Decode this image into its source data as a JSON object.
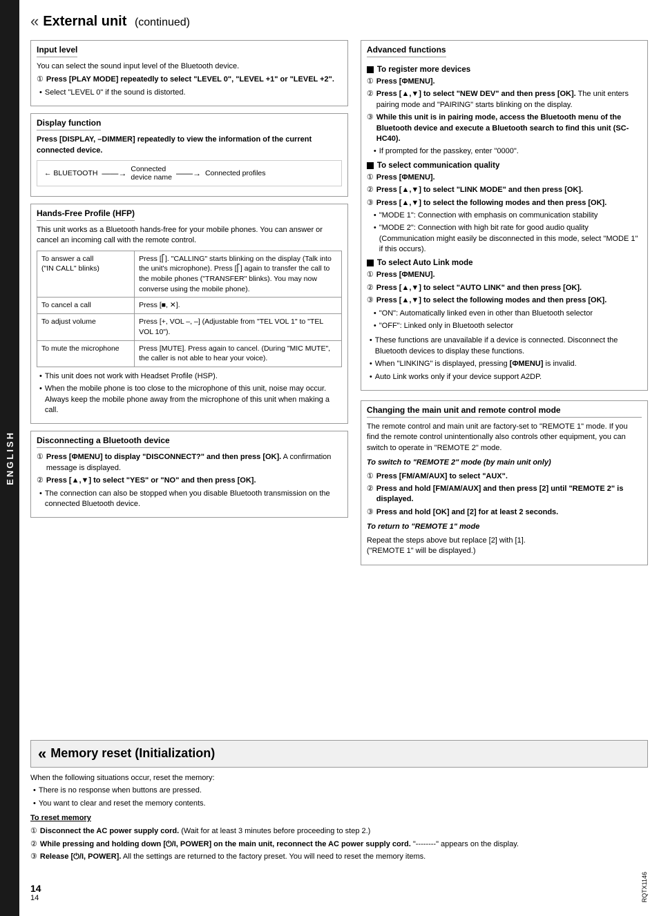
{
  "page": {
    "title": "External unit",
    "title_continued": "(continued)",
    "sidebar_label": "ENGLISH",
    "page_number": "14",
    "doc_code": "RQTX1146",
    "header_icon": "«"
  },
  "input_level": {
    "title": "Input level",
    "description": "You can select the sound input level of the Bluetooth device.",
    "step1": "Press [PLAY MODE] repeatedly to select \"LEVEL 0\", \"LEVEL +1\" or \"LEVEL +2\".",
    "bullet1": "Select \"LEVEL 0\" if the sound is distorted."
  },
  "display_function": {
    "title": "Display function",
    "description": "Press [DISPLAY, –DIMMER] repeatedly to view the information of the current connected device.",
    "diagram": {
      "start": "BLUETOOTH",
      "arrow1": "→",
      "mid": "Connected device name",
      "arrow2": "→",
      "end": "Connected profiles"
    }
  },
  "hfp": {
    "title": "Hands-Free Profile (HFP)",
    "description": "This unit works as a Bluetooth hands-free for your mobile phones. You can answer or cancel an incoming call with the remote control.",
    "table_rows": [
      {
        "action": "To answer a call (\"IN CALL\" blinks)",
        "description": "Press [  ]. \"CALLING\" starts blinking on the display (Talk into the unit's microphone). Press [  ] again to transfer the call to the mobile phones (\"TRANSFER\" blinks). You may now converse using the mobile phone)."
      },
      {
        "action": "To cancel a call",
        "description": "Press [■, ✕]."
      },
      {
        "action": "To adjust volume",
        "description": "Press [+, VOL –, –] (Adjustable from \"TEL VOL 1\" to \"TEL VOL 10\")."
      },
      {
        "action": "To mute the microphone",
        "description": "Press [MUTE]. Press again to cancel. (During \"MIC MUTE\", the caller is not able to hear your voice)."
      }
    ],
    "bullets": [
      "This unit does not work with Headset Profile (HSP).",
      "When the mobile phone is too close to the microphone of this unit, noise may occur. Always keep the mobile phone away from the microphone of this unit when making a call."
    ]
  },
  "disconnecting": {
    "title": "Disconnecting a Bluetooth device",
    "step1": "Press [ΦMENU] to display \"DISCONNECT?\" and then press [OK]. A confirmation message is displayed.",
    "step2": "Press [▲,▼] to select \"YES\" or \"NO\" and then press [OK].",
    "bullet1": "The connection can also be stopped when you disable Bluetooth transmission on the connected Bluetooth device."
  },
  "advanced_functions": {
    "title": "Advanced functions",
    "register_title": "To register more devices",
    "register_steps": [
      "Press [ΦMENU].",
      "Press [▲,▼] to select \"NEW DEV\" and then press [OK]. The unit enters pairing mode and \"PAIRING\" starts blinking on the display.",
      "While this unit is in pairing mode, access the Bluetooth menu of the Bluetooth device and execute a Bluetooth search to find this unit (SC-HC40)."
    ],
    "register_bullet": "If prompted for the passkey, enter \"0000\".",
    "comm_quality_title": "To select communication quality",
    "comm_quality_steps": [
      "Press [ΦMENU].",
      "Press [▲,▼] to select \"LINK MODE\" and then press [OK].",
      "Press [▲,▼] to select the following modes and then press [OK]."
    ],
    "comm_quality_bullets": [
      "\"MODE 1\": Connection with emphasis on communication stability",
      "\"MODE 2\": Connection with high bit rate for good audio quality (Communication might easily be disconnected in this mode, select \"MODE 1\" if this occurs)."
    ],
    "auto_link_title": "To select Auto Link mode",
    "auto_link_steps": [
      "Press [ΦMENU].",
      "Press [▲,▼] to select \"AUTO LINK\" and then press [OK].",
      "Press [▲,▼] to select the following modes and then press [OK]."
    ],
    "auto_link_bullets": [
      "\"ON\": Automatically linked even in other than Bluetooth selector",
      "\"OFF\": Linked only in Bluetooth selector"
    ],
    "extra_bullets": [
      "These functions are unavailable if a device is connected. Disconnect the Bluetooth devices to display these functions.",
      "When \"LINKING\" is displayed, pressing [ΦMENU] is invalid.",
      "Auto Link works only if your device support A2DP."
    ]
  },
  "changing_mode": {
    "title": "Changing the main unit and remote control mode",
    "description": "The remote control and main unit are factory-set to \"REMOTE 1\" mode. If you find the remote control unintentionally also controls other equipment, you can switch to operate in \"REMOTE 2\" mode.",
    "remote2_title": "To switch to \"REMOTE 2\" mode (by main unit only)",
    "remote2_steps": [
      "Press [FM/AM/AUX] to select \"AUX\".",
      "Press and hold [FM/AM/AUX] and then press [2] until \"REMOTE 2\" is displayed.",
      "Press and hold [OK] and [2] for at least 2 seconds."
    ],
    "remote1_title": "To return to \"REMOTE 1\" mode",
    "remote1_description": "Repeat the steps above but replace [2] with [1]. (\"REMOTE 1\" will be displayed.)"
  },
  "memory_reset": {
    "title": "Memory reset (Initialization)",
    "icon": "«",
    "description": "When the following situations occur, reset the memory:",
    "bullets": [
      "There is no response when buttons are pressed.",
      "You want to clear and reset the memory contents."
    ],
    "reset_title": "To reset memory",
    "steps": [
      "Disconnect the AC power supply cord. (Wait for at least 3 minutes before proceeding to step 2.)",
      "While pressing and holding down [⏻/I, POWER] on the main unit, reconnect the AC power supply cord. \"--------\" appears on the display.",
      "Release [⏻/I, POWER]. All the settings are returned to the factory preset. You will need to reset the memory items."
    ]
  }
}
